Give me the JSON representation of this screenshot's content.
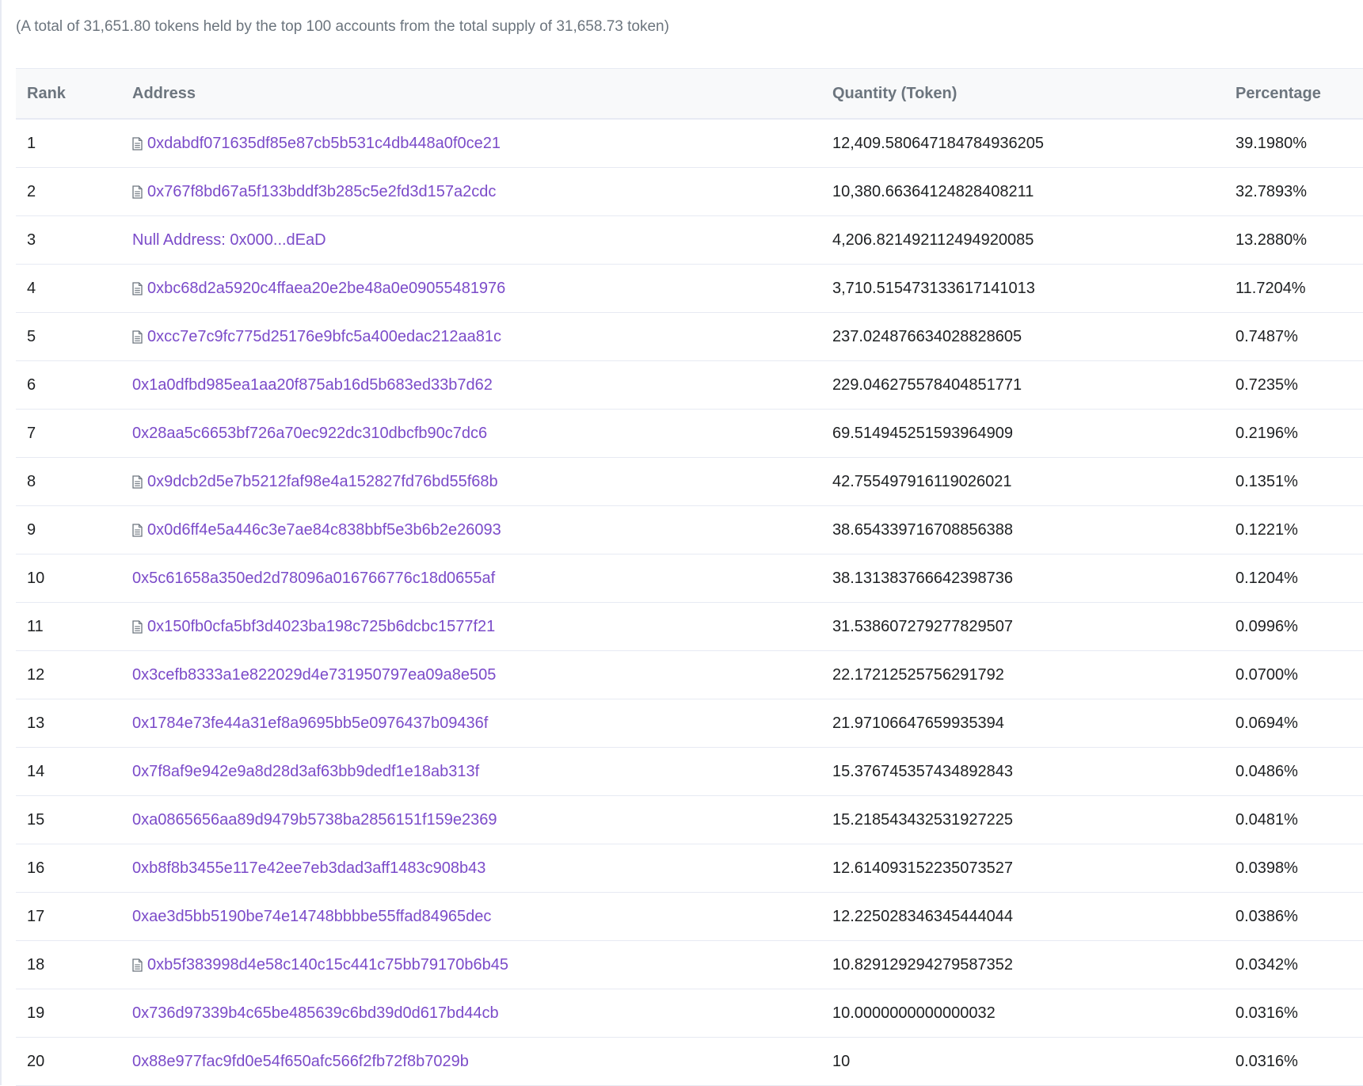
{
  "summary": "(A total of 31,651.80 tokens held by the top 100 accounts from the total supply of 31,658.73 token)",
  "columns": {
    "rank": "Rank",
    "address": "Address",
    "quantity": "Quantity (Token)",
    "percentage": "Percentage"
  },
  "colors": {
    "link": "#7b4bc9",
    "text": "#1e2022",
    "muted": "#6c757e",
    "border": "#e7eaf3"
  },
  "rows": [
    {
      "rank": "1",
      "address": "0xdabdf071635df85e87cb5b531c4db448a0f0ce21",
      "contract": true,
      "quantity": "12,409.580647184784936205",
      "percentage": "39.1980%"
    },
    {
      "rank": "2",
      "address": "0x767f8bd67a5f133bddf3b285c5e2fd3d157a2cdc",
      "contract": true,
      "quantity": "10,380.66364124828408211",
      "percentage": "32.7893%"
    },
    {
      "rank": "3",
      "address": "Null Address: 0x000...dEaD",
      "contract": false,
      "quantity": "4,206.821492112494920085",
      "percentage": "13.2880%"
    },
    {
      "rank": "4",
      "address": "0xbc68d2a5920c4ffaea20e2be48a0e09055481976",
      "contract": true,
      "quantity": "3,710.515473133617141013",
      "percentage": "11.7204%"
    },
    {
      "rank": "5",
      "address": "0xcc7e7c9fc775d25176e9bfc5a400edac212aa81c",
      "contract": true,
      "quantity": "237.024876634028828605",
      "percentage": "0.7487%"
    },
    {
      "rank": "6",
      "address": "0x1a0dfbd985ea1aa20f875ab16d5b683ed33b7d62",
      "contract": false,
      "quantity": "229.046275578404851771",
      "percentage": "0.7235%"
    },
    {
      "rank": "7",
      "address": "0x28aa5c6653bf726a70ec922dc310dbcfb90c7dc6",
      "contract": false,
      "quantity": "69.514945251593964909",
      "percentage": "0.2196%"
    },
    {
      "rank": "8",
      "address": "0x9dcb2d5e7b5212faf98e4a152827fd76bd55f68b",
      "contract": true,
      "quantity": "42.755497916119026021",
      "percentage": "0.1351%"
    },
    {
      "rank": "9",
      "address": "0x0d6ff4e5a446c3e7ae84c838bbf5e3b6b2e26093",
      "contract": true,
      "quantity": "38.654339716708856388",
      "percentage": "0.1221%"
    },
    {
      "rank": "10",
      "address": "0x5c61658a350ed2d78096a016766776c18d0655af",
      "contract": false,
      "quantity": "38.131383766642398736",
      "percentage": "0.1204%"
    },
    {
      "rank": "11",
      "address": "0x150fb0cfa5bf3d4023ba198c725b6dcbc1577f21",
      "contract": true,
      "quantity": "31.538607279277829507",
      "percentage": "0.0996%"
    },
    {
      "rank": "12",
      "address": "0x3cefb8333a1e822029d4e731950797ea09a8e505",
      "contract": false,
      "quantity": "22.17212525756291792",
      "percentage": "0.0700%"
    },
    {
      "rank": "13",
      "address": "0x1784e73fe44a31ef8a9695bb5e0976437b09436f",
      "contract": false,
      "quantity": "21.97106647659935394",
      "percentage": "0.0694%"
    },
    {
      "rank": "14",
      "address": "0x7f8af9e942e9a8d28d3af63bb9dedf1e18ab313f",
      "contract": false,
      "quantity": "15.376745357434892843",
      "percentage": "0.0486%"
    },
    {
      "rank": "15",
      "address": "0xa0865656aa89d9479b5738ba2856151f159e2369",
      "contract": false,
      "quantity": "15.218543432531927225",
      "percentage": "0.0481%"
    },
    {
      "rank": "16",
      "address": "0xb8f8b3455e117e42ee7eb3dad3aff1483c908b43",
      "contract": false,
      "quantity": "12.614093152235073527",
      "percentage": "0.0398%"
    },
    {
      "rank": "17",
      "address": "0xae3d5bb5190be74e14748bbbbe55ffad84965dec",
      "contract": false,
      "quantity": "12.225028346345444044",
      "percentage": "0.0386%"
    },
    {
      "rank": "18",
      "address": "0xb5f383998d4e58c140c15c441c75bb79170b6b45",
      "contract": true,
      "quantity": "10.829129294279587352",
      "percentage": "0.0342%"
    },
    {
      "rank": "19",
      "address": "0x736d97339b4c65be485639c6bd39d0d617bd44cb",
      "contract": false,
      "quantity": "10.0000000000000032",
      "percentage": "0.0316%"
    },
    {
      "rank": "20",
      "address": "0x88e977fac9fd0e54f650afc566f2fb72f8b7029b",
      "contract": false,
      "quantity": "10",
      "percentage": "0.0316%"
    }
  ]
}
